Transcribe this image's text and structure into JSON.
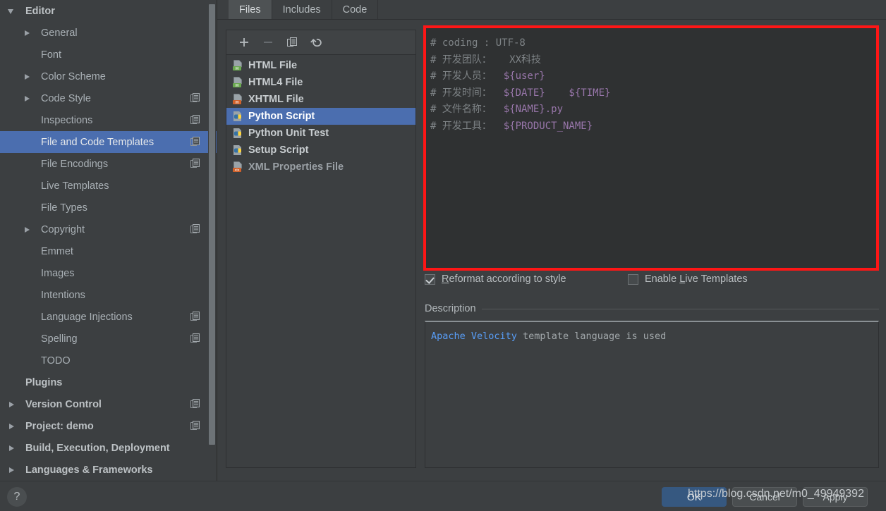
{
  "sidebar": {
    "items": [
      {
        "label": "Editor",
        "indent": 0,
        "arrow": "down",
        "bold": true,
        "copy": false,
        "selected": false
      },
      {
        "label": "General",
        "indent": 1,
        "arrow": "right",
        "bold": false,
        "copy": false,
        "selected": false
      },
      {
        "label": "Font",
        "indent": 1,
        "arrow": "none",
        "bold": false,
        "copy": false,
        "selected": false
      },
      {
        "label": "Color Scheme",
        "indent": 1,
        "arrow": "right",
        "bold": false,
        "copy": false,
        "selected": false
      },
      {
        "label": "Code Style",
        "indent": 1,
        "arrow": "right",
        "bold": false,
        "copy": true,
        "selected": false
      },
      {
        "label": "Inspections",
        "indent": 1,
        "arrow": "none",
        "bold": false,
        "copy": true,
        "selected": false
      },
      {
        "label": "File and Code Templates",
        "indent": 1,
        "arrow": "none",
        "bold": false,
        "copy": true,
        "selected": true
      },
      {
        "label": "File Encodings",
        "indent": 1,
        "arrow": "none",
        "bold": false,
        "copy": true,
        "selected": false
      },
      {
        "label": "Live Templates",
        "indent": 1,
        "arrow": "none",
        "bold": false,
        "copy": false,
        "selected": false
      },
      {
        "label": "File Types",
        "indent": 1,
        "arrow": "none",
        "bold": false,
        "copy": false,
        "selected": false
      },
      {
        "label": "Copyright",
        "indent": 1,
        "arrow": "right",
        "bold": false,
        "copy": true,
        "selected": false
      },
      {
        "label": "Emmet",
        "indent": 1,
        "arrow": "none",
        "bold": false,
        "copy": false,
        "selected": false
      },
      {
        "label": "Images",
        "indent": 1,
        "arrow": "none",
        "bold": false,
        "copy": false,
        "selected": false
      },
      {
        "label": "Intentions",
        "indent": 1,
        "arrow": "none",
        "bold": false,
        "copy": false,
        "selected": false
      },
      {
        "label": "Language Injections",
        "indent": 1,
        "arrow": "none",
        "bold": false,
        "copy": true,
        "selected": false
      },
      {
        "label": "Spelling",
        "indent": 1,
        "arrow": "none",
        "bold": false,
        "copy": true,
        "selected": false
      },
      {
        "label": "TODO",
        "indent": 1,
        "arrow": "none",
        "bold": false,
        "copy": false,
        "selected": false
      },
      {
        "label": "Plugins",
        "indent": 0,
        "arrow": "none",
        "bold": true,
        "copy": false,
        "selected": false
      },
      {
        "label": "Version Control",
        "indent": 0,
        "arrow": "right",
        "bold": true,
        "copy": true,
        "selected": false
      },
      {
        "label": "Project: demo",
        "indent": 0,
        "arrow": "right",
        "bold": true,
        "copy": true,
        "selected": false
      },
      {
        "label": "Build, Execution, Deployment",
        "indent": 0,
        "arrow": "right",
        "bold": true,
        "copy": false,
        "selected": false
      },
      {
        "label": "Languages & Frameworks",
        "indent": 0,
        "arrow": "right",
        "bold": true,
        "copy": false,
        "selected": false
      }
    ]
  },
  "tabs": [
    {
      "label": "Files",
      "active": true
    },
    {
      "label": "Includes",
      "active": false
    },
    {
      "label": "Code",
      "active": false
    }
  ],
  "list_toolbar": [
    {
      "name": "add-icon",
      "glyph": "+",
      "enabled": true
    },
    {
      "name": "remove-icon",
      "glyph": "−",
      "enabled": false
    },
    {
      "name": "copy-icon",
      "glyph": "copy",
      "enabled": true
    },
    {
      "name": "reset-icon",
      "glyph": "undo",
      "enabled": true
    }
  ],
  "templates": [
    {
      "label": "HTML File",
      "icon": "html-file-icon",
      "icon_color": "#6aa84f",
      "icon_letter": "H",
      "selected": false,
      "dim": false
    },
    {
      "label": "HTML4 File",
      "icon": "html4-file-icon",
      "icon_color": "#6aa84f",
      "icon_letter": "H",
      "selected": false,
      "dim": false
    },
    {
      "label": "XHTML File",
      "icon": "xhtml-file-icon",
      "icon_color": "#d1622b",
      "icon_letter": "H",
      "selected": false,
      "dim": false
    },
    {
      "label": "Python Script",
      "icon": "python-file-icon",
      "icon_color": "#3572a5",
      "icon_letter": "py",
      "selected": true,
      "dim": false
    },
    {
      "label": "Python Unit Test",
      "icon": "python-file-icon",
      "icon_color": "#3572a5",
      "icon_letter": "py",
      "selected": false,
      "dim": false
    },
    {
      "label": "Setup Script",
      "icon": "python-file-icon",
      "icon_color": "#3572a5",
      "icon_letter": "py",
      "selected": false,
      "dim": false
    },
    {
      "label": "XML Properties File",
      "icon": "xml-properties-file-icon",
      "icon_color": "#d1622b",
      "icon_letter": "<>",
      "selected": false,
      "dim": true
    }
  ],
  "editor": {
    "highlight_color": "#fe1616",
    "comment_color": "#7e8386",
    "variable_color": "#9876aa",
    "lines": [
      {
        "comment": "# coding : UTF-8",
        "vars": ""
      },
      {
        "comment": "# 开发团队：   XX科技",
        "vars": ""
      },
      {
        "comment": "# 开发人员：  ",
        "vars": "${user}"
      },
      {
        "comment": "# 开发时间：  ",
        "vars": "${DATE}    ${TIME}"
      },
      {
        "comment": "# 文件名称：  ",
        "vars": "${NAME}.py"
      },
      {
        "comment": "# 开发工具：  ",
        "vars": "${PRODUCT_NAME}"
      }
    ]
  },
  "options": {
    "reformat": {
      "label_pre": "",
      "mnemonic": "R",
      "label_post": "eformat according to style",
      "checked": true
    },
    "live_templates": {
      "label_pre": "Enable ",
      "mnemonic": "L",
      "label_post": "ive Templates",
      "checked": false
    }
  },
  "description": {
    "header": "Description",
    "link_text": "Apache Velocity",
    "body_text": " template language is used"
  },
  "footer": {
    "help": "?",
    "ok": "OK",
    "cancel": "Cancel",
    "apply": "Apply",
    "watermark": "https://blog.csdn.net/m0_49949392"
  }
}
